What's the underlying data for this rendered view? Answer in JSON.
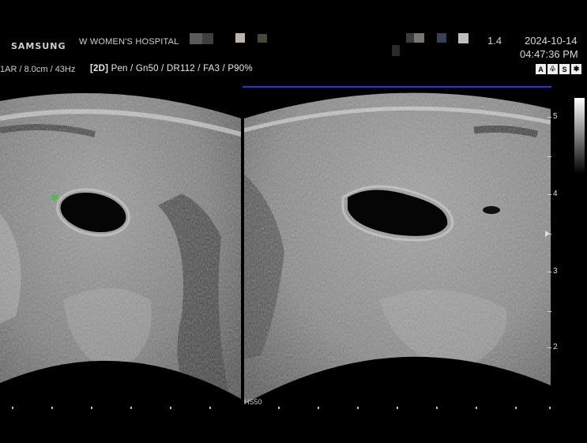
{
  "header": {
    "brand": "SAMSUNG",
    "hospital": "W WOMEN'S HOSPITAL",
    "zoom": "1.4",
    "date": "2024-10-14",
    "time": "04:47:36 PM"
  },
  "params": {
    "probe_info": "1AR / 8.0cm / 43Hz",
    "mode_label": "[2D]",
    "mode_settings": "Pen / Gn50 / DR112 / FA3 / P90%"
  },
  "mode_icons": [
    "A",
    "♧",
    "S",
    "✱"
  ],
  "depth_scale": {
    "labels": [
      "5",
      "4",
      "3",
      "2"
    ]
  },
  "image": {
    "harmonic_label": "HS50"
  },
  "colors": {
    "accent_line": "#2233ee",
    "marker": "#2ec42e"
  }
}
